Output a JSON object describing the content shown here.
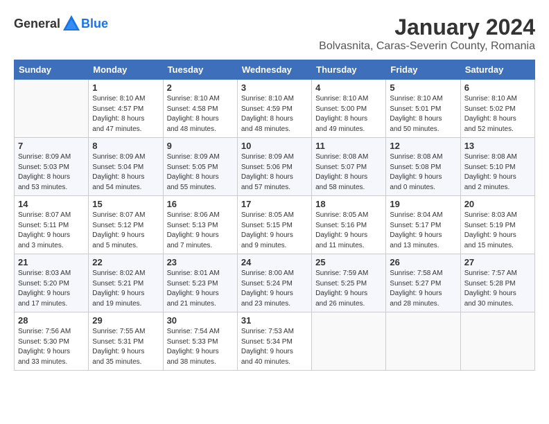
{
  "logo": {
    "general": "General",
    "blue": "Blue"
  },
  "header": {
    "month": "January 2024",
    "location": "Bolvasnita, Caras-Severin County, Romania"
  },
  "weekdays": [
    "Sunday",
    "Monday",
    "Tuesday",
    "Wednesday",
    "Thursday",
    "Friday",
    "Saturday"
  ],
  "weeks": [
    [
      {
        "day": "",
        "info": ""
      },
      {
        "day": "1",
        "info": "Sunrise: 8:10 AM\nSunset: 4:57 PM\nDaylight: 8 hours\nand 47 minutes."
      },
      {
        "day": "2",
        "info": "Sunrise: 8:10 AM\nSunset: 4:58 PM\nDaylight: 8 hours\nand 48 minutes."
      },
      {
        "day": "3",
        "info": "Sunrise: 8:10 AM\nSunset: 4:59 PM\nDaylight: 8 hours\nand 48 minutes."
      },
      {
        "day": "4",
        "info": "Sunrise: 8:10 AM\nSunset: 5:00 PM\nDaylight: 8 hours\nand 49 minutes."
      },
      {
        "day": "5",
        "info": "Sunrise: 8:10 AM\nSunset: 5:01 PM\nDaylight: 8 hours\nand 50 minutes."
      },
      {
        "day": "6",
        "info": "Sunrise: 8:10 AM\nSunset: 5:02 PM\nDaylight: 8 hours\nand 52 minutes."
      }
    ],
    [
      {
        "day": "7",
        "info": "Sunrise: 8:09 AM\nSunset: 5:03 PM\nDaylight: 8 hours\nand 53 minutes."
      },
      {
        "day": "8",
        "info": "Sunrise: 8:09 AM\nSunset: 5:04 PM\nDaylight: 8 hours\nand 54 minutes."
      },
      {
        "day": "9",
        "info": "Sunrise: 8:09 AM\nSunset: 5:05 PM\nDaylight: 8 hours\nand 55 minutes."
      },
      {
        "day": "10",
        "info": "Sunrise: 8:09 AM\nSunset: 5:06 PM\nDaylight: 8 hours\nand 57 minutes."
      },
      {
        "day": "11",
        "info": "Sunrise: 8:08 AM\nSunset: 5:07 PM\nDaylight: 8 hours\nand 58 minutes."
      },
      {
        "day": "12",
        "info": "Sunrise: 8:08 AM\nSunset: 5:08 PM\nDaylight: 9 hours\nand 0 minutes."
      },
      {
        "day": "13",
        "info": "Sunrise: 8:08 AM\nSunset: 5:10 PM\nDaylight: 9 hours\nand 2 minutes."
      }
    ],
    [
      {
        "day": "14",
        "info": "Sunrise: 8:07 AM\nSunset: 5:11 PM\nDaylight: 9 hours\nand 3 minutes."
      },
      {
        "day": "15",
        "info": "Sunrise: 8:07 AM\nSunset: 5:12 PM\nDaylight: 9 hours\nand 5 minutes."
      },
      {
        "day": "16",
        "info": "Sunrise: 8:06 AM\nSunset: 5:13 PM\nDaylight: 9 hours\nand 7 minutes."
      },
      {
        "day": "17",
        "info": "Sunrise: 8:05 AM\nSunset: 5:15 PM\nDaylight: 9 hours\nand 9 minutes."
      },
      {
        "day": "18",
        "info": "Sunrise: 8:05 AM\nSunset: 5:16 PM\nDaylight: 9 hours\nand 11 minutes."
      },
      {
        "day": "19",
        "info": "Sunrise: 8:04 AM\nSunset: 5:17 PM\nDaylight: 9 hours\nand 13 minutes."
      },
      {
        "day": "20",
        "info": "Sunrise: 8:03 AM\nSunset: 5:19 PM\nDaylight: 9 hours\nand 15 minutes."
      }
    ],
    [
      {
        "day": "21",
        "info": "Sunrise: 8:03 AM\nSunset: 5:20 PM\nDaylight: 9 hours\nand 17 minutes."
      },
      {
        "day": "22",
        "info": "Sunrise: 8:02 AM\nSunset: 5:21 PM\nDaylight: 9 hours\nand 19 minutes."
      },
      {
        "day": "23",
        "info": "Sunrise: 8:01 AM\nSunset: 5:23 PM\nDaylight: 9 hours\nand 21 minutes."
      },
      {
        "day": "24",
        "info": "Sunrise: 8:00 AM\nSunset: 5:24 PM\nDaylight: 9 hours\nand 23 minutes."
      },
      {
        "day": "25",
        "info": "Sunrise: 7:59 AM\nSunset: 5:25 PM\nDaylight: 9 hours\nand 26 minutes."
      },
      {
        "day": "26",
        "info": "Sunrise: 7:58 AM\nSunset: 5:27 PM\nDaylight: 9 hours\nand 28 minutes."
      },
      {
        "day": "27",
        "info": "Sunrise: 7:57 AM\nSunset: 5:28 PM\nDaylight: 9 hours\nand 30 minutes."
      }
    ],
    [
      {
        "day": "28",
        "info": "Sunrise: 7:56 AM\nSunset: 5:30 PM\nDaylight: 9 hours\nand 33 minutes."
      },
      {
        "day": "29",
        "info": "Sunrise: 7:55 AM\nSunset: 5:31 PM\nDaylight: 9 hours\nand 35 minutes."
      },
      {
        "day": "30",
        "info": "Sunrise: 7:54 AM\nSunset: 5:33 PM\nDaylight: 9 hours\nand 38 minutes."
      },
      {
        "day": "31",
        "info": "Sunrise: 7:53 AM\nSunset: 5:34 PM\nDaylight: 9 hours\nand 40 minutes."
      },
      {
        "day": "",
        "info": ""
      },
      {
        "day": "",
        "info": ""
      },
      {
        "day": "",
        "info": ""
      }
    ]
  ]
}
